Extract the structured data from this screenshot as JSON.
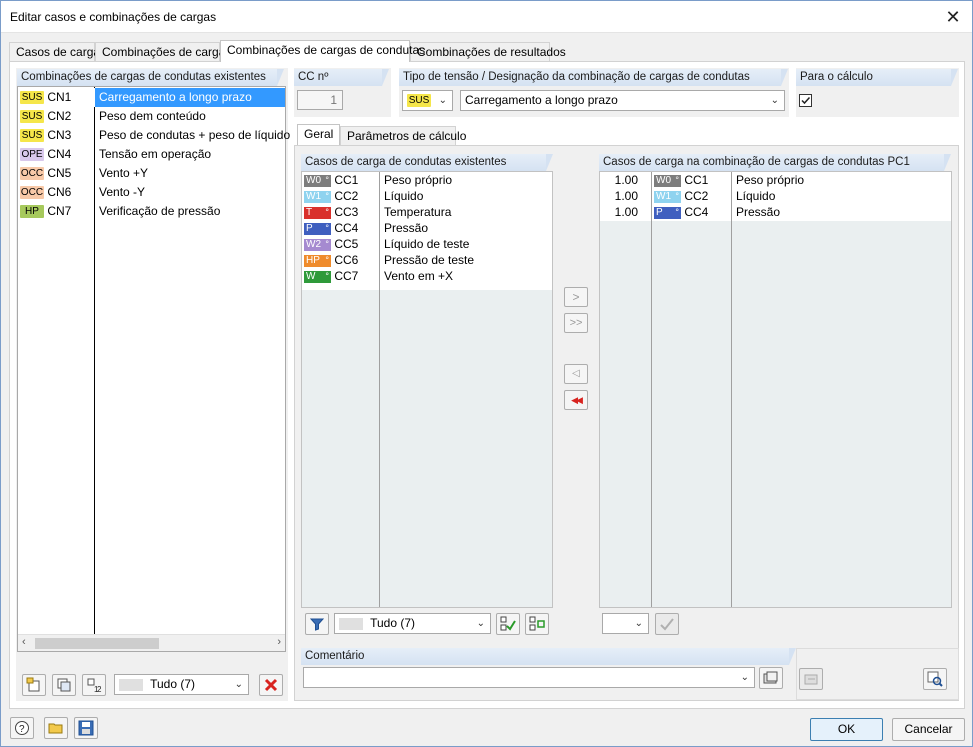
{
  "window": {
    "title": "Editar casos e combinações de cargas",
    "close_glyph": "✕"
  },
  "tabs": [
    {
      "label": "Casos de carga"
    },
    {
      "label": "Combinações de cargas"
    },
    {
      "label": "Combinações de cargas de condutas",
      "active": true
    },
    {
      "label": "Combinações de resultados"
    }
  ],
  "left_panel": {
    "header": "Combinações de cargas de condutas existentes",
    "items": [
      {
        "badge": "SUS",
        "badge_color": "#f5e64a",
        "id": "CN1",
        "name": "Carregamento a longo prazo",
        "selected": true
      },
      {
        "badge": "SUS",
        "badge_color": "#f5e64a",
        "id": "CN2",
        "name": "Peso dem conteúdo"
      },
      {
        "badge": "SUS",
        "badge_color": "#f5e64a",
        "id": "CN3",
        "name": "Peso de condutas + peso de líquido"
      },
      {
        "badge": "OPE",
        "badge_color": "#d9c8ec",
        "id": "CN4",
        "name": "Tensão em operação"
      },
      {
        "badge": "OCC",
        "badge_color": "#f8c9a8",
        "id": "CN5",
        "name": "Vento +Y"
      },
      {
        "badge": "OCC",
        "badge_color": "#f8c9a8",
        "id": "CN6",
        "name": "Vento -Y"
      },
      {
        "badge": "HP",
        "badge_color": "#a6c95c",
        "id": "CN7",
        "name": "Verificação de pressão"
      }
    ],
    "filter_value": "Tudo (7)"
  },
  "cc_no": {
    "label": "CC nº",
    "value": "1"
  },
  "stress_type": {
    "label": "Tipo de tensão / Designação da combinação de cargas de condutas",
    "type_value": "SUS",
    "designation": "Carregamento a longo prazo"
  },
  "for_calc": {
    "label": "Para o cálculo",
    "checked": true
  },
  "subtabs": [
    {
      "label": "Geral",
      "active": true
    },
    {
      "label": "Parâmetros de cálculo"
    }
  ],
  "existing_lc": {
    "header": "Casos de carga de condutas existentes",
    "items": [
      {
        "tag": "W0",
        "color": "#7d7d7d",
        "id": "CC1",
        "name": "Peso próprio"
      },
      {
        "tag": "W1",
        "color": "#8fd3ef",
        "id": "CC2",
        "name": "Líquido"
      },
      {
        "tag": "T",
        "color": "#d9302c",
        "id": "CC3",
        "name": "Temperatura"
      },
      {
        "tag": "P",
        "color": "#3f5fbf",
        "id": "CC4",
        "name": "Pressão"
      },
      {
        "tag": "W2",
        "color": "#a58ad0",
        "id": "CC5",
        "name": "Líquido de teste"
      },
      {
        "tag": "HP",
        "color": "#ef8b2c",
        "id": "CC6",
        "name": "Pressão de teste"
      },
      {
        "tag": "W",
        "color": "#2f9a3a",
        "id": "CC7",
        "name": "Vento em +X"
      }
    ],
    "filter_value": "Tudo (7)"
  },
  "combo_lc": {
    "header": "Casos de carga na combinação de cargas de condutas PC1",
    "items": [
      {
        "factor": "1.00",
        "tag": "W0",
        "color": "#7d7d7d",
        "id": "CC1",
        "name": "Peso próprio"
      },
      {
        "factor": "1.00",
        "tag": "W1",
        "color": "#8fd3ef",
        "id": "CC2",
        "name": "Líquido"
      },
      {
        "factor": "1.00",
        "tag": "P",
        "color": "#3f5fbf",
        "id": "CC4",
        "name": "Pressão"
      }
    ]
  },
  "transfer": {
    "add": ">",
    "add_all": ">>",
    "remove": "◁",
    "remove_all": "◀◀"
  },
  "comment": {
    "label": "Comentário",
    "value": ""
  },
  "buttons": {
    "ok": "OK",
    "cancel": "Cancelar"
  }
}
